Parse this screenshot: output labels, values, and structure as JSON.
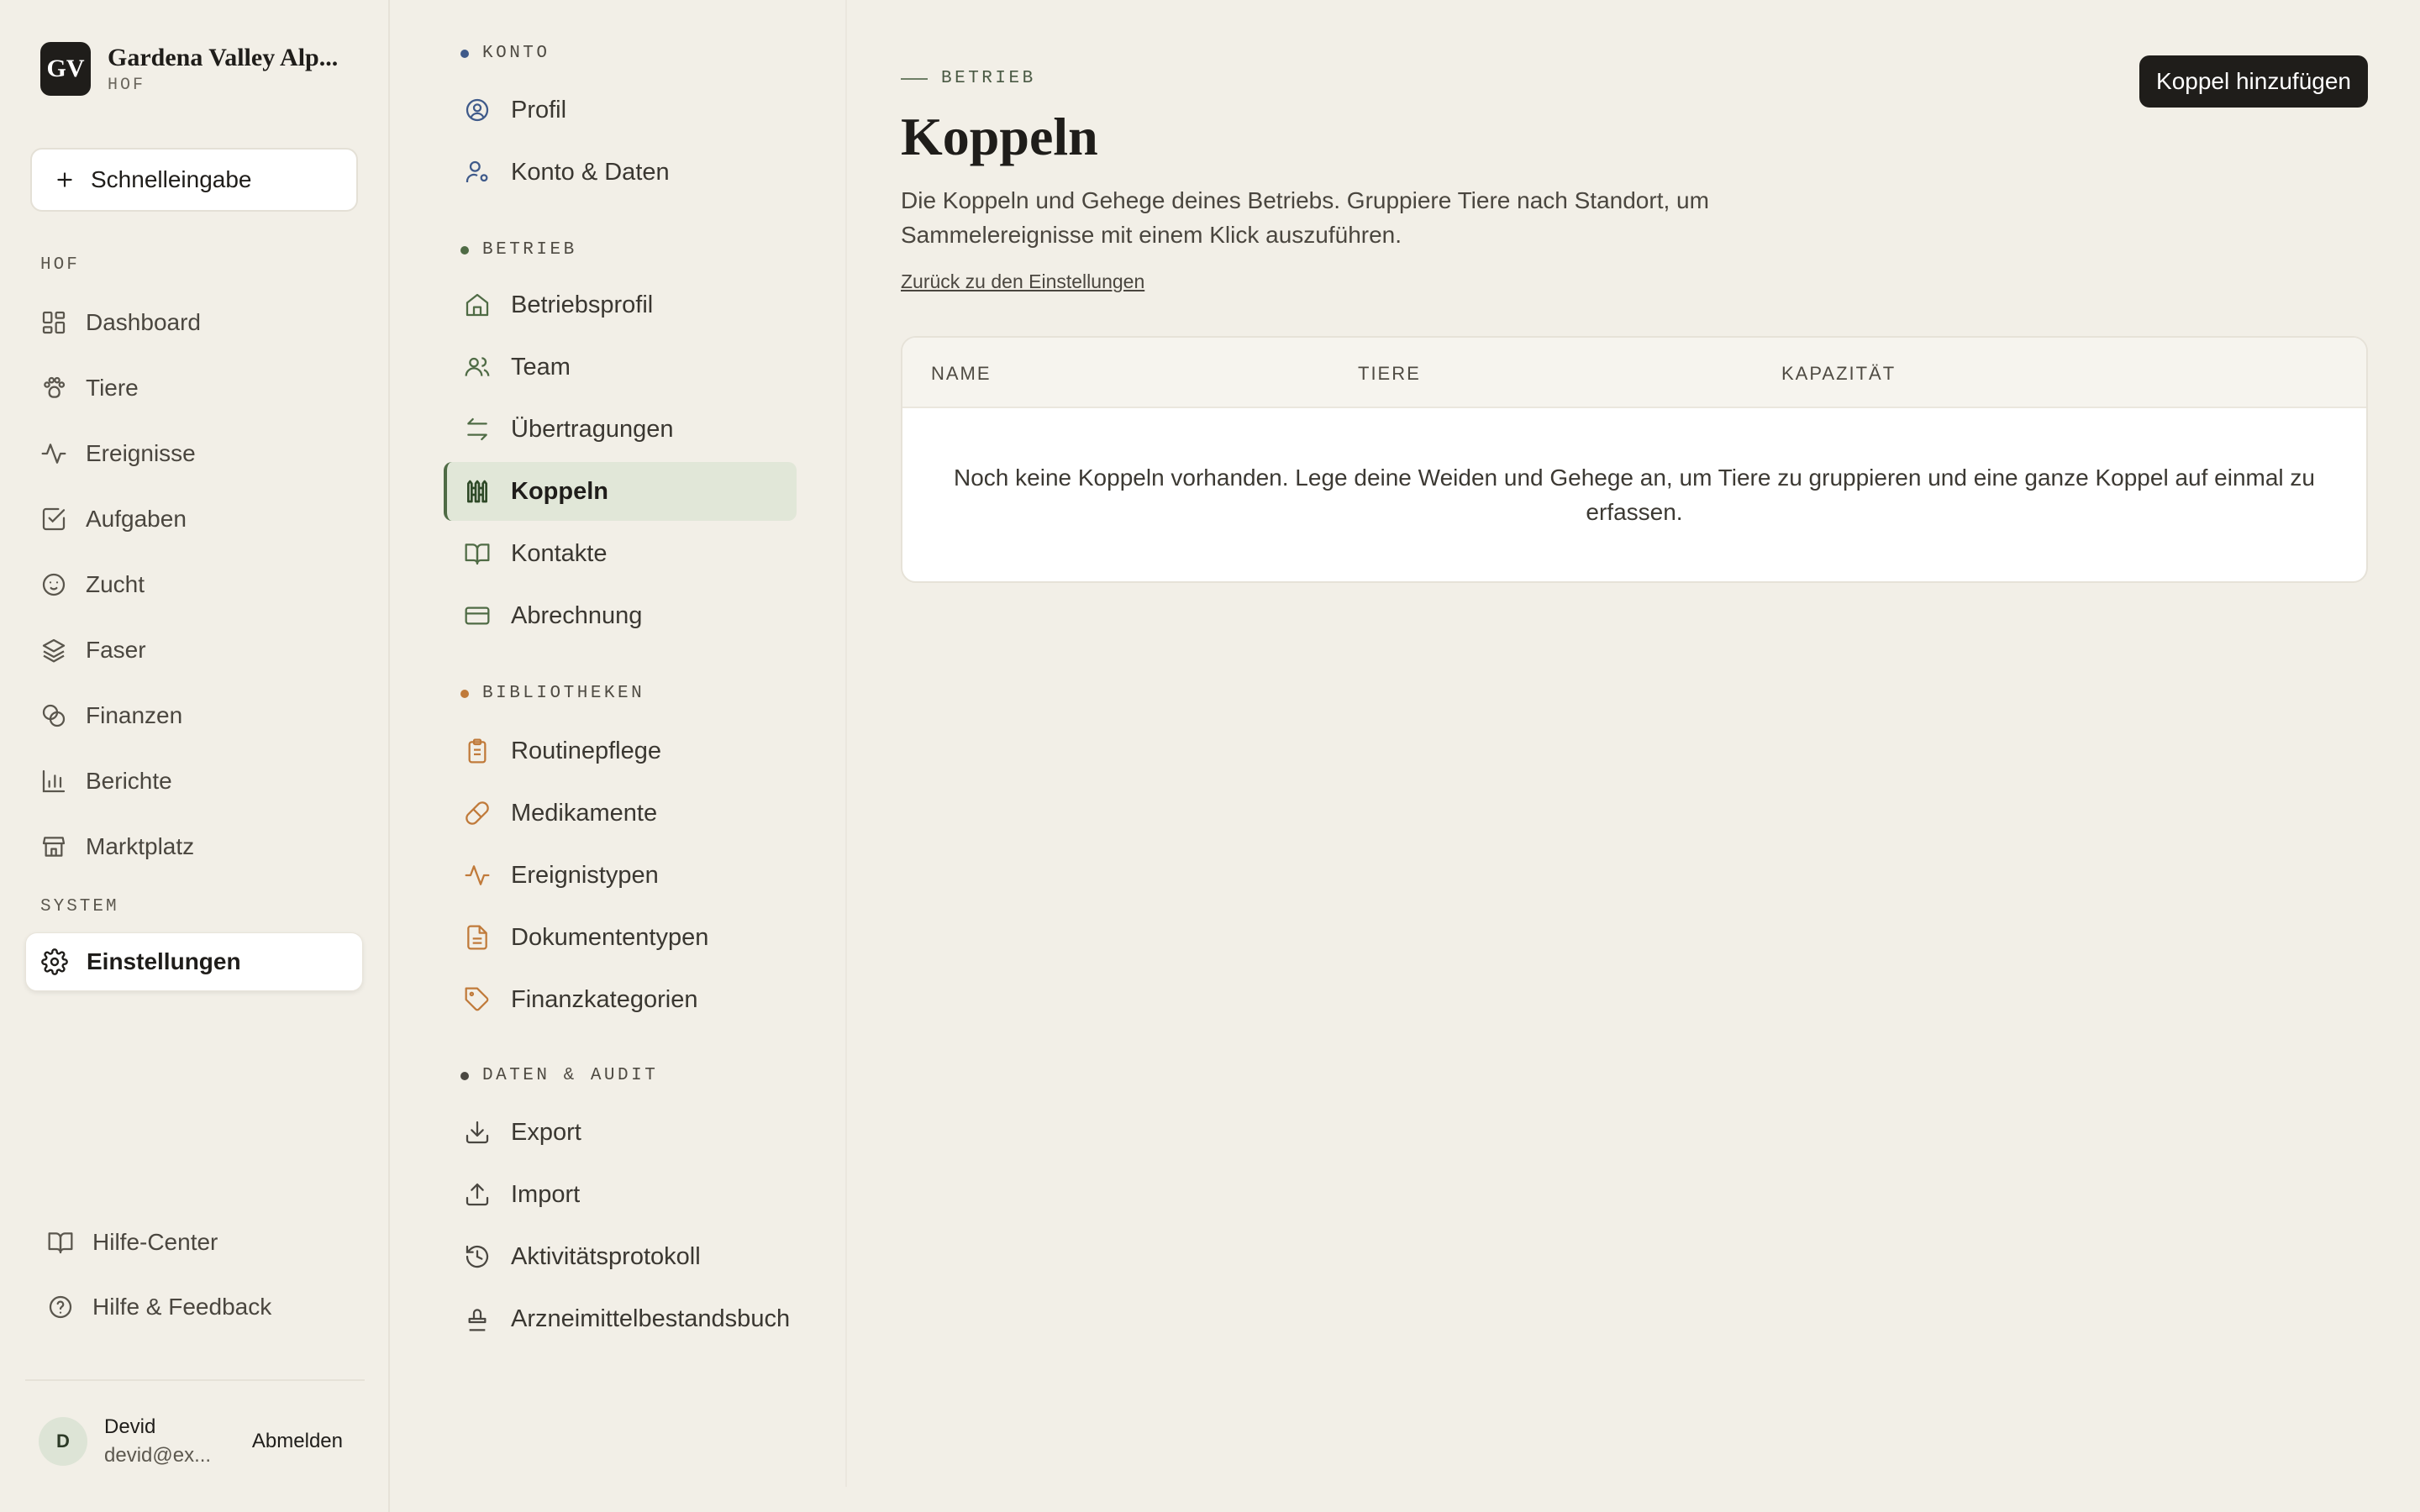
{
  "brand": {
    "initials": "GV",
    "name": "Gardena Valley Alp...",
    "sub": "HOF"
  },
  "quick_entry": {
    "label": "Schnelleingabe"
  },
  "sidebar": {
    "section_hof": "HOF",
    "items": [
      {
        "label": "Dashboard",
        "icon": "grid-icon"
      },
      {
        "label": "Tiere",
        "icon": "paw-icon"
      },
      {
        "label": "Ereignisse",
        "icon": "activity-icon"
      },
      {
        "label": "Aufgaben",
        "icon": "checkbox-icon"
      },
      {
        "label": "Zucht",
        "icon": "baby-icon"
      },
      {
        "label": "Faser",
        "icon": "layers-icon"
      },
      {
        "label": "Finanzen",
        "icon": "coins-icon"
      },
      {
        "label": "Berichte",
        "icon": "bar-chart-icon"
      },
      {
        "label": "Marktplatz",
        "icon": "store-icon"
      }
    ],
    "section_system": "SYSTEM",
    "settings": {
      "label": "Einstellungen",
      "icon": "gear-icon"
    },
    "footer": [
      {
        "label": "Hilfe-Center",
        "icon": "book-icon"
      },
      {
        "label": "Hilfe & Feedback",
        "icon": "help-circle-icon"
      }
    ]
  },
  "user": {
    "initial": "D",
    "name": "Devid",
    "email": "devid@ex...",
    "logout": "Abmelden"
  },
  "settings_nav": {
    "sections": [
      {
        "title": "KONTO",
        "dot": "#3f5a8a",
        "items": [
          {
            "label": "Profil",
            "icon": "user-circle-icon"
          },
          {
            "label": "Konto & Daten",
            "icon": "user-cog-icon"
          }
        ]
      },
      {
        "title": "BETRIEB",
        "dot": "#4f6b45",
        "items": [
          {
            "label": "Betriebsprofil",
            "icon": "home-icon"
          },
          {
            "label": "Team",
            "icon": "users-icon"
          },
          {
            "label": "Übertragungen",
            "icon": "arrows-icon"
          },
          {
            "label": "Koppeln",
            "icon": "fence-icon"
          },
          {
            "label": "Kontakte",
            "icon": "book-open-icon"
          },
          {
            "label": "Abrechnung",
            "icon": "credit-card-icon"
          }
        ]
      },
      {
        "title": "BIBLIOTHEKEN",
        "dot": "#c07a3a",
        "items": [
          {
            "label": "Routinepflege",
            "icon": "clipboard-icon"
          },
          {
            "label": "Medikamente",
            "icon": "pill-icon"
          },
          {
            "label": "Ereignistypen",
            "icon": "activity-icon"
          },
          {
            "label": "Dokumententypen",
            "icon": "file-text-icon"
          },
          {
            "label": "Finanzkategorien",
            "icon": "tag-icon"
          }
        ]
      },
      {
        "title": "DATEN & AUDIT",
        "dot": "#4a4741",
        "items": [
          {
            "label": "Export",
            "icon": "download-icon"
          },
          {
            "label": "Import",
            "icon": "upload-icon"
          },
          {
            "label": "Aktivitätsprotokoll",
            "icon": "history-icon"
          },
          {
            "label": "Arzneimittelbestandsbuch",
            "icon": "stamp-icon"
          }
        ]
      }
    ]
  },
  "main": {
    "eyebrow": "BETRIEB",
    "title": "Koppeln",
    "description": "Die Koppeln und Gehege deines Betriebs. Gruppiere Tiere nach Standort, um Sammelereignisse mit einem Klick auszuführen.",
    "back_link": "Zurück zu den Einstellungen",
    "add_button": "Koppel hinzufügen",
    "table": {
      "columns": [
        "NAME",
        "TIERE",
        "KAPAZITÄT"
      ],
      "empty": "Noch keine Koppeln vorhanden. Lege deine Weiden und Gehege an, um Tiere zu gruppieren und eine ganze Koppel auf einmal zu erfassen."
    }
  },
  "colors": {
    "background": "#f2efe7",
    "accent_green": "#4f6b45",
    "accent_blue": "#3f5a8a",
    "accent_orange": "#c07a3a",
    "dark": "#1f1d1a"
  }
}
